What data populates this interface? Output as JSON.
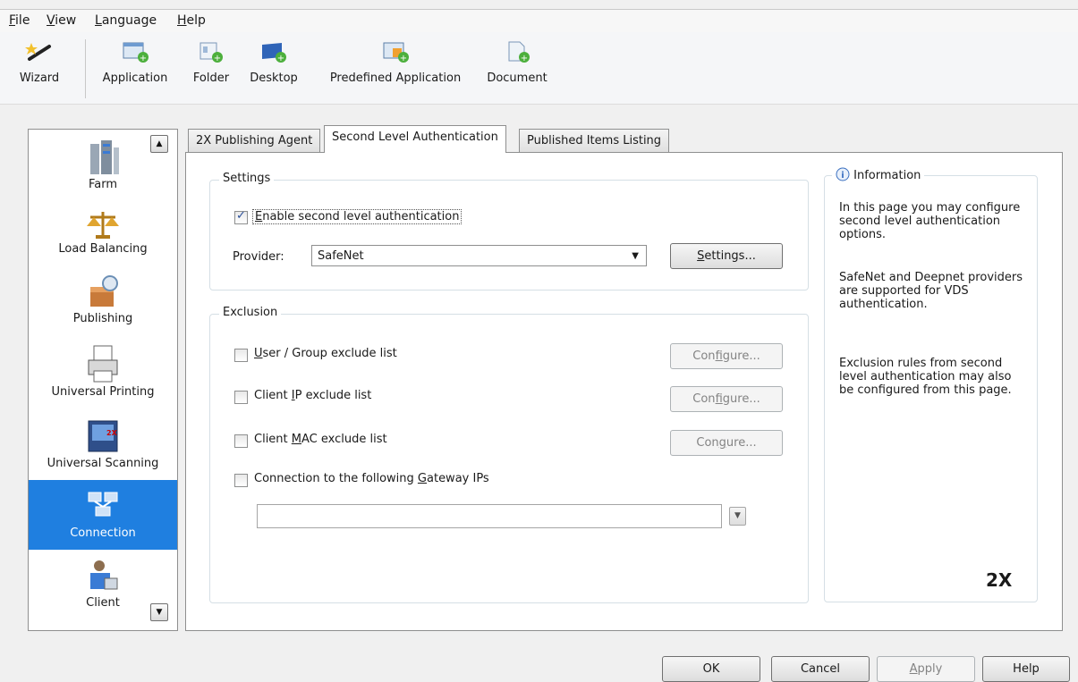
{
  "menu": {
    "items": [
      {
        "label": "File",
        "accel": "F",
        "rest": "ile"
      },
      {
        "label": "View",
        "accel": "V",
        "rest": "iew"
      },
      {
        "label": "Language",
        "accel": "L",
        "rest": "anguage"
      },
      {
        "label": "Help",
        "accel": "H",
        "rest": "elp"
      }
    ]
  },
  "toolbar": {
    "wizard": "Wizard",
    "application": "Application",
    "folder": "Folder",
    "desktop": "Desktop",
    "predefined_application": "Predefined Application",
    "document": "Document"
  },
  "nav": {
    "items": [
      {
        "label": "Farm",
        "icon": "farm-icon"
      },
      {
        "label": "Load Balancing",
        "icon": "load-balancing-icon"
      },
      {
        "label": "Publishing",
        "icon": "publishing-icon"
      },
      {
        "label": "Universal Printing",
        "icon": "printer-icon"
      },
      {
        "label": "Universal Scanning",
        "icon": "scanner-icon"
      },
      {
        "label": "Connection",
        "icon": "connection-icon"
      },
      {
        "label": "Client",
        "icon": "client-icon"
      }
    ],
    "selected": "Connection",
    "scanner_badge": "2X"
  },
  "tabs": {
    "items": [
      {
        "label": "2X Publishing Agent"
      },
      {
        "label": "Second Level Authentication"
      },
      {
        "label": "Published Items Listing"
      }
    ],
    "active": "Second Level Authentication"
  },
  "settings": {
    "title": "Settings",
    "enable_accel": "E",
    "enable_rest": "nable second level authentication",
    "enable_checked": true,
    "provider_label": "Provider:",
    "provider_value": "SafeNet",
    "settings_btn_accel": "S",
    "settings_btn_rest": "ettings..."
  },
  "exclusion": {
    "title": "Exclusion",
    "user_group": {
      "accel": "U",
      "rest": "ser / Group exclude list",
      "checked": false
    },
    "client_ip": {
      "pre": "Client ",
      "accel": "I",
      "rest": "P exclude list",
      "checked": false
    },
    "client_mac": {
      "pre": "Client ",
      "accel": "M",
      "rest": "AC exclude list",
      "checked": false
    },
    "gateway": {
      "pre": "Connection to the following ",
      "accel": "G",
      "rest": "ateway IPs",
      "checked": false
    },
    "configure_pre": "Con",
    "configure_accel": "f",
    "configure_rest": "igure...",
    "configure_g_pre": "Con",
    "configure_g_accel": "g",
    "configure_g_rest": "ure...",
    "gateway_value": ""
  },
  "info": {
    "title": "Information",
    "p1": "In this page you may configure second level authentication options.",
    "p2": "SafeNet and Deepnet providers are supported for VDS authentication.",
    "p3": "Exclusion rules from second level authentication may also be configured from this page.",
    "logo": "2X"
  },
  "footer": {
    "ok": "OK",
    "cancel": "Cancel",
    "apply_accel": "A",
    "apply_rest": "pply",
    "help": "Help"
  },
  "colors": {
    "selection": "#1f7fe0",
    "check": "#2a4f9a"
  }
}
